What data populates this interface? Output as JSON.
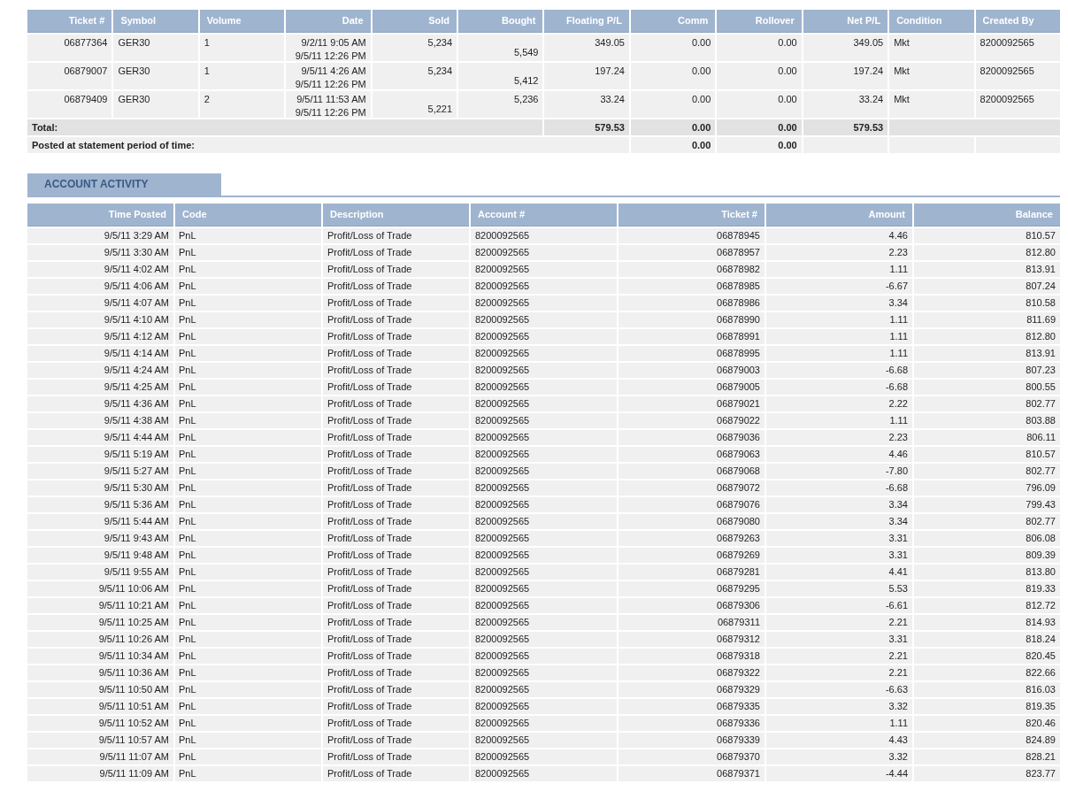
{
  "trades": {
    "columns": [
      "Ticket #",
      "Symbol",
      "Volume",
      "Date",
      "Sold",
      "Bought",
      "Floating P/L",
      "Comm",
      "Rollover",
      "Net P/L",
      "Condition",
      "Created By"
    ],
    "rows": [
      {
        "ticket": "06877364",
        "symbol": "GER30",
        "volume": "1",
        "date": [
          "9/2/11 9:05 AM",
          "9/5/11 12:26 PM"
        ],
        "sold": {
          "value": "5,234",
          "lowered": false
        },
        "bought": {
          "value": "5,549",
          "lowered": true
        },
        "floating_pl": "349.05",
        "comm": "0.00",
        "rollover": "0.00",
        "net_pl": "349.05",
        "condition": "Mkt",
        "created_by": "8200092565"
      },
      {
        "ticket": "06879007",
        "symbol": "GER30",
        "volume": "1",
        "date": [
          "9/5/11 4:26 AM",
          "9/5/11 12:26 PM"
        ],
        "sold": {
          "value": "5,234",
          "lowered": false
        },
        "bought": {
          "value": "5,412",
          "lowered": true
        },
        "floating_pl": "197.24",
        "comm": "0.00",
        "rollover": "0.00",
        "net_pl": "197.24",
        "condition": "Mkt",
        "created_by": "8200092565"
      },
      {
        "ticket": "06879409",
        "symbol": "GER30",
        "volume": "2",
        "date": [
          "9/5/11 11:53 AM",
          "9/5/11 12:26 PM"
        ],
        "sold": {
          "value": "5,221",
          "lowered": true
        },
        "bought": {
          "value": "5,236",
          "lowered": false
        },
        "floating_pl": "33.24",
        "comm": "0.00",
        "rollover": "0.00",
        "net_pl": "33.24",
        "condition": "Mkt",
        "created_by": "8200092565"
      }
    ],
    "total": {
      "label": "Total:",
      "floating_pl": "579.53",
      "comm": "0.00",
      "rollover": "0.00",
      "net_pl": "579.53"
    },
    "posted": {
      "label": "Posted at statement period of time:",
      "comm": "0.00",
      "rollover": "0.00"
    }
  },
  "activity": {
    "title": "ACCOUNT ACTIVITY",
    "columns": [
      "Time Posted",
      "Code",
      "Description",
      "Account #",
      "Ticket #",
      "Amount",
      "Balance"
    ],
    "rows": [
      [
        "9/5/11 3:29 AM",
        "PnL",
        "Profit/Loss of Trade",
        "8200092565",
        "06878945",
        "4.46",
        "810.57"
      ],
      [
        "9/5/11 3:30 AM",
        "PnL",
        "Profit/Loss of Trade",
        "8200092565",
        "06878957",
        "2.23",
        "812.80"
      ],
      [
        "9/5/11 4:02 AM",
        "PnL",
        "Profit/Loss of Trade",
        "8200092565",
        "06878982",
        "1.11",
        "813.91"
      ],
      [
        "9/5/11 4:06 AM",
        "PnL",
        "Profit/Loss of Trade",
        "8200092565",
        "06878985",
        "-6.67",
        "807.24"
      ],
      [
        "9/5/11 4:07 AM",
        "PnL",
        "Profit/Loss of Trade",
        "8200092565",
        "06878986",
        "3.34",
        "810.58"
      ],
      [
        "9/5/11 4:10 AM",
        "PnL",
        "Profit/Loss of Trade",
        "8200092565",
        "06878990",
        "1.11",
        "811.69"
      ],
      [
        "9/5/11 4:12 AM",
        "PnL",
        "Profit/Loss of Trade",
        "8200092565",
        "06878991",
        "1.11",
        "812.80"
      ],
      [
        "9/5/11 4:14 AM",
        "PnL",
        "Profit/Loss of Trade",
        "8200092565",
        "06878995",
        "1.11",
        "813.91"
      ],
      [
        "9/5/11 4:24 AM",
        "PnL",
        "Profit/Loss of Trade",
        "8200092565",
        "06879003",
        "-6.68",
        "807.23"
      ],
      [
        "9/5/11 4:25 AM",
        "PnL",
        "Profit/Loss of Trade",
        "8200092565",
        "06879005",
        "-6.68",
        "800.55"
      ],
      [
        "9/5/11 4:36 AM",
        "PnL",
        "Profit/Loss of Trade",
        "8200092565",
        "06879021",
        "2.22",
        "802.77"
      ],
      [
        "9/5/11 4:38 AM",
        "PnL",
        "Profit/Loss of Trade",
        "8200092565",
        "06879022",
        "1.11",
        "803.88"
      ],
      [
        "9/5/11 4:44 AM",
        "PnL",
        "Profit/Loss of Trade",
        "8200092565",
        "06879036",
        "2.23",
        "806.11"
      ],
      [
        "9/5/11 5:19 AM",
        "PnL",
        "Profit/Loss of Trade",
        "8200092565",
        "06879063",
        "4.46",
        "810.57"
      ],
      [
        "9/5/11 5:27 AM",
        "PnL",
        "Profit/Loss of Trade",
        "8200092565",
        "06879068",
        "-7.80",
        "802.77"
      ],
      [
        "9/5/11 5:30 AM",
        "PnL",
        "Profit/Loss of Trade",
        "8200092565",
        "06879072",
        "-6.68",
        "796.09"
      ],
      [
        "9/5/11 5:36 AM",
        "PnL",
        "Profit/Loss of Trade",
        "8200092565",
        "06879076",
        "3.34",
        "799.43"
      ],
      [
        "9/5/11 5:44 AM",
        "PnL",
        "Profit/Loss of Trade",
        "8200092565",
        "06879080",
        "3.34",
        "802.77"
      ],
      [
        "9/5/11 9:43 AM",
        "PnL",
        "Profit/Loss of Trade",
        "8200092565",
        "06879263",
        "3.31",
        "806.08"
      ],
      [
        "9/5/11 9:48 AM",
        "PnL",
        "Profit/Loss of Trade",
        "8200092565",
        "06879269",
        "3.31",
        "809.39"
      ],
      [
        "9/5/11 9:55 AM",
        "PnL",
        "Profit/Loss of Trade",
        "8200092565",
        "06879281",
        "4.41",
        "813.80"
      ],
      [
        "9/5/11 10:06 AM",
        "PnL",
        "Profit/Loss of Trade",
        "8200092565",
        "06879295",
        "5.53",
        "819.33"
      ],
      [
        "9/5/11 10:21 AM",
        "PnL",
        "Profit/Loss of Trade",
        "8200092565",
        "06879306",
        "-6.61",
        "812.72"
      ],
      [
        "9/5/11 10:25 AM",
        "PnL",
        "Profit/Loss of Trade",
        "8200092565",
        "06879311",
        "2.21",
        "814.93"
      ],
      [
        "9/5/11 10:26 AM",
        "PnL",
        "Profit/Loss of Trade",
        "8200092565",
        "06879312",
        "3.31",
        "818.24"
      ],
      [
        "9/5/11 10:34 AM",
        "PnL",
        "Profit/Loss of Trade",
        "8200092565",
        "06879318",
        "2.21",
        "820.45"
      ],
      [
        "9/5/11 10:36 AM",
        "PnL",
        "Profit/Loss of Trade",
        "8200092565",
        "06879322",
        "2.21",
        "822.66"
      ],
      [
        "9/5/11 10:50 AM",
        "PnL",
        "Profit/Loss of Trade",
        "8200092565",
        "06879329",
        "-6.63",
        "816.03"
      ],
      [
        "9/5/11 10:51 AM",
        "PnL",
        "Profit/Loss of Trade",
        "8200092565",
        "06879335",
        "3.32",
        "819.35"
      ],
      [
        "9/5/11 10:52 AM",
        "PnL",
        "Profit/Loss of Trade",
        "8200092565",
        "06879336",
        "1.11",
        "820.46"
      ],
      [
        "9/5/11 10:57 AM",
        "PnL",
        "Profit/Loss of Trade",
        "8200092565",
        "06879339",
        "4.43",
        "824.89"
      ],
      [
        "9/5/11 11:07 AM",
        "PnL",
        "Profit/Loss of Trade",
        "8200092565",
        "06879370",
        "3.32",
        "828.21"
      ],
      [
        "9/5/11 11:09 AM",
        "PnL",
        "Profit/Loss of Trade",
        "8200092565",
        "06879371",
        "-4.44",
        "823.77"
      ]
    ]
  }
}
